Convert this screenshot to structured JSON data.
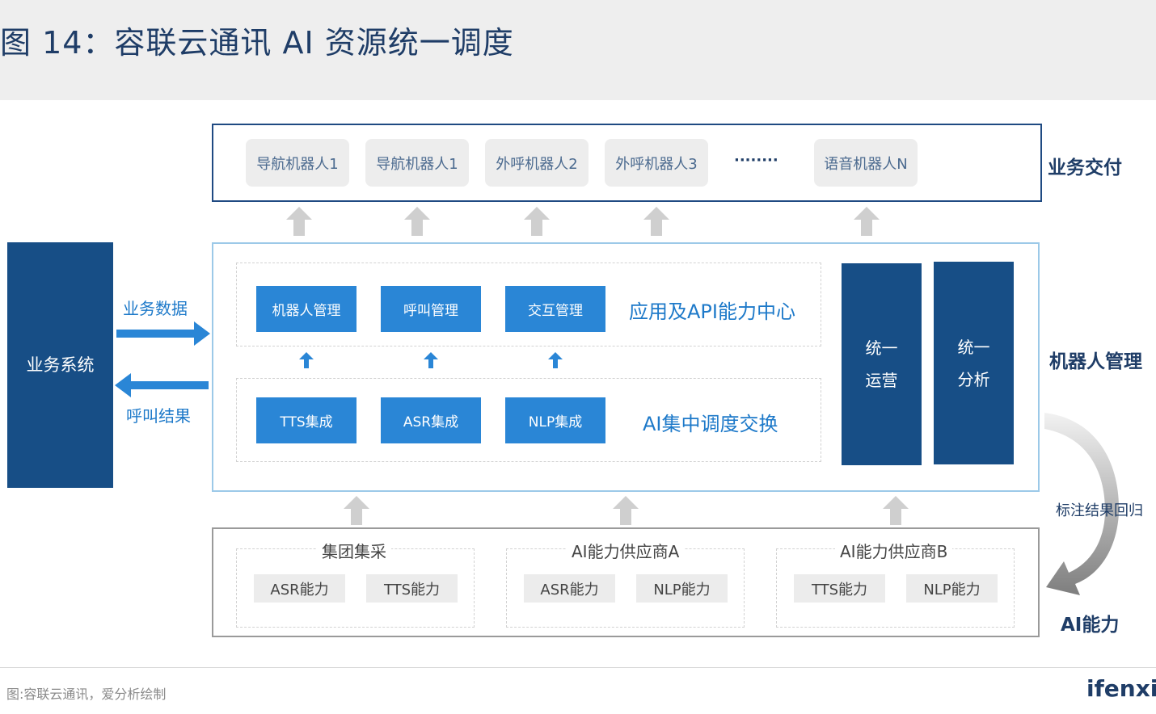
{
  "title": "图 14：容联云通讯 AI 资源统一调度",
  "delivery": {
    "label": "业务交付",
    "items": [
      "导航机器人1",
      "导航机器人1",
      "外呼机器人2",
      "外呼机器人3",
      "语音机器人N"
    ],
    "ellipsis": "········"
  },
  "business_system": {
    "label": "业务系统",
    "data_label": "业务数据",
    "result_label": "呼叫结果"
  },
  "robot_mgmt": {
    "label": "机器人管理",
    "app_row": {
      "buttons": [
        "机器人管理",
        "呼叫管理",
        "交互管理"
      ],
      "label": "应用及API能力中心"
    },
    "ai_row": {
      "buttons": [
        "TTS集成",
        "ASR集成",
        "NLP集成"
      ],
      "label": "AI集中调度交换"
    },
    "ops": {
      "line1": "统一",
      "line2": "运营"
    },
    "analysis": {
      "line1": "统一",
      "line2": "分析"
    }
  },
  "feedback_label": "标注结果回归",
  "ai_capability": {
    "label": "AI能力",
    "groups": [
      {
        "name": "集团集采",
        "items": [
          "ASR能力",
          "TTS能力"
        ]
      },
      {
        "name": "AI能力供应商A",
        "items": [
          "ASR能力",
          "NLP能力"
        ]
      },
      {
        "name": "AI能力供应商B",
        "items": [
          "TTS能力",
          "NLP能力"
        ]
      }
    ]
  },
  "footer": {
    "source": "图:容联云通讯，爱分析绘制",
    "logo": "ifenxi"
  },
  "colors": {
    "navy": "#174e86",
    "blue": "#2a86d6",
    "title": "#1f3d67",
    "arrow_gray": "#cfcfcf"
  }
}
